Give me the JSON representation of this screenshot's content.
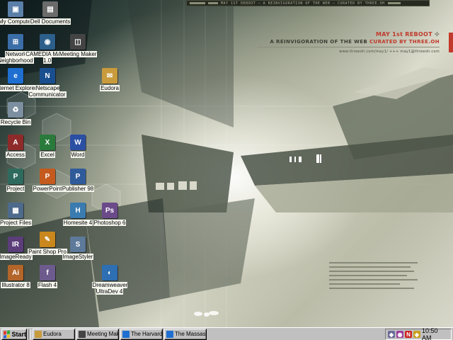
{
  "wallpaper": {
    "top_strip_text": "MAY 1ST REBOOT — A REINVIGORATION OF THE WEB — CURATED BY THREE.OH",
    "title": "MAY 1st REBOOT",
    "subtitle_prefix": "A REINVIGORATION OF THE WEB ",
    "subtitle_highlight": "CURATED BY THREE.OH",
    "links": "www.threeoh.com/may1/   +++   may1@threeoh.com",
    "accent_color": "#c0392b"
  },
  "desktop_icons": [
    {
      "label": "My Computer",
      "icon": "computer-icon",
      "color": "#5a7fa8",
      "glyph": "▣"
    },
    {
      "label": "Dell Documents",
      "icon": "folder-icon",
      "color": "#6b6b6b",
      "glyph": "▤"
    },
    {
      "label": "Network Neighborhood",
      "icon": "network-icon",
      "color": "#3b6ea8",
      "glyph": "⊞"
    },
    {
      "label": "CAMEDIA Master 1.0",
      "icon": "camera-icon",
      "color": "#2c5f8a",
      "glyph": "◉"
    },
    {
      "label": "Meeting Maker",
      "icon": "meeting-icon",
      "color": "#444444",
      "glyph": "◫"
    },
    {
      "label": "Internet Explorer",
      "icon": "ie-icon",
      "color": "#1f6fd1",
      "glyph": "e"
    },
    {
      "label": "Netscape Communicator",
      "icon": "netscape-icon",
      "color": "#1a4f8f",
      "glyph": "N"
    },
    {
      "label": "Eudora",
      "icon": "mail-icon",
      "color": "#c89b3c",
      "glyph": "✉"
    },
    {
      "label": "Recycle Bin",
      "icon": "recycle-bin-icon",
      "color": "#7c8fa0",
      "glyph": "♻"
    },
    {
      "label": "Access",
      "icon": "access-icon",
      "color": "#8e2a2a",
      "glyph": "A"
    },
    {
      "label": "Excel",
      "icon": "excel-icon",
      "color": "#2a7a3b",
      "glyph": "X"
    },
    {
      "label": "Word",
      "icon": "word-icon",
      "color": "#2b4fa3",
      "glyph": "W"
    },
    {
      "label": "Project",
      "icon": "project-icon",
      "color": "#2e6b5e",
      "glyph": "P"
    },
    {
      "label": "PowerPoint",
      "icon": "powerpoint-icon",
      "color": "#c45a1e",
      "glyph": "P"
    },
    {
      "label": "Publisher 98",
      "icon": "publisher-icon",
      "color": "#2f5b9b",
      "glyph": "P"
    },
    {
      "label": "Project Files",
      "icon": "project-files-icon",
      "color": "#4e6a8c",
      "glyph": "▦"
    },
    {
      "label": "Homesite 4",
      "icon": "homesite-icon",
      "color": "#3a7bb0",
      "glyph": "H"
    },
    {
      "label": "Photoshop 6",
      "icon": "photoshop-icon",
      "color": "#6b4a8a",
      "glyph": "Ps"
    },
    {
      "label": "ImageReady",
      "icon": "imageready-icon",
      "color": "#5b3d7a",
      "glyph": "IR"
    },
    {
      "label": "Paint Shop Pro",
      "icon": "paintshop-icon",
      "color": "#c9871e",
      "glyph": "✎"
    },
    {
      "label": "ImageStyler",
      "icon": "imagestyler-icon",
      "color": "#5e7a9a",
      "glyph": "S"
    },
    {
      "label": "Illustrator 8",
      "icon": "illustrator-icon",
      "color": "#b3652a",
      "glyph": "Ai"
    },
    {
      "label": "Flash 4",
      "icon": "flash-icon",
      "color": "#6d5b8e",
      "glyph": "f"
    },
    {
      "label": "Dreamweaver UltraDev 4",
      "icon": "dreamweaver-icon",
      "color": "#2d6fb2",
      "glyph": "◐"
    }
  ],
  "taskbar": {
    "start_label": "Start",
    "tasks": [
      {
        "label": "Eudora",
        "icon": "mail-icon",
        "color": "#c89b3c"
      },
      {
        "label": "Meeting Mak...",
        "icon": "meeting-icon",
        "color": "#444444"
      },
      {
        "label": "The Harvard ...",
        "icon": "ie-icon",
        "color": "#1f6fd1"
      },
      {
        "label": "The Massass...",
        "icon": "ie-icon",
        "color": "#1f6fd1"
      }
    ],
    "tray_icons": [
      {
        "name": "volume-icon",
        "color": "#6b6b9a",
        "glyph": "◆"
      },
      {
        "name": "network-tray-icon",
        "color": "#9a3a9a",
        "glyph": "◉"
      },
      {
        "name": "netscape-tray-icon",
        "color": "#cc2222",
        "glyph": "N"
      },
      {
        "name": "shield-tray-icon",
        "color": "#c8a020",
        "glyph": "◈"
      }
    ],
    "clock": "10:50 AM"
  }
}
